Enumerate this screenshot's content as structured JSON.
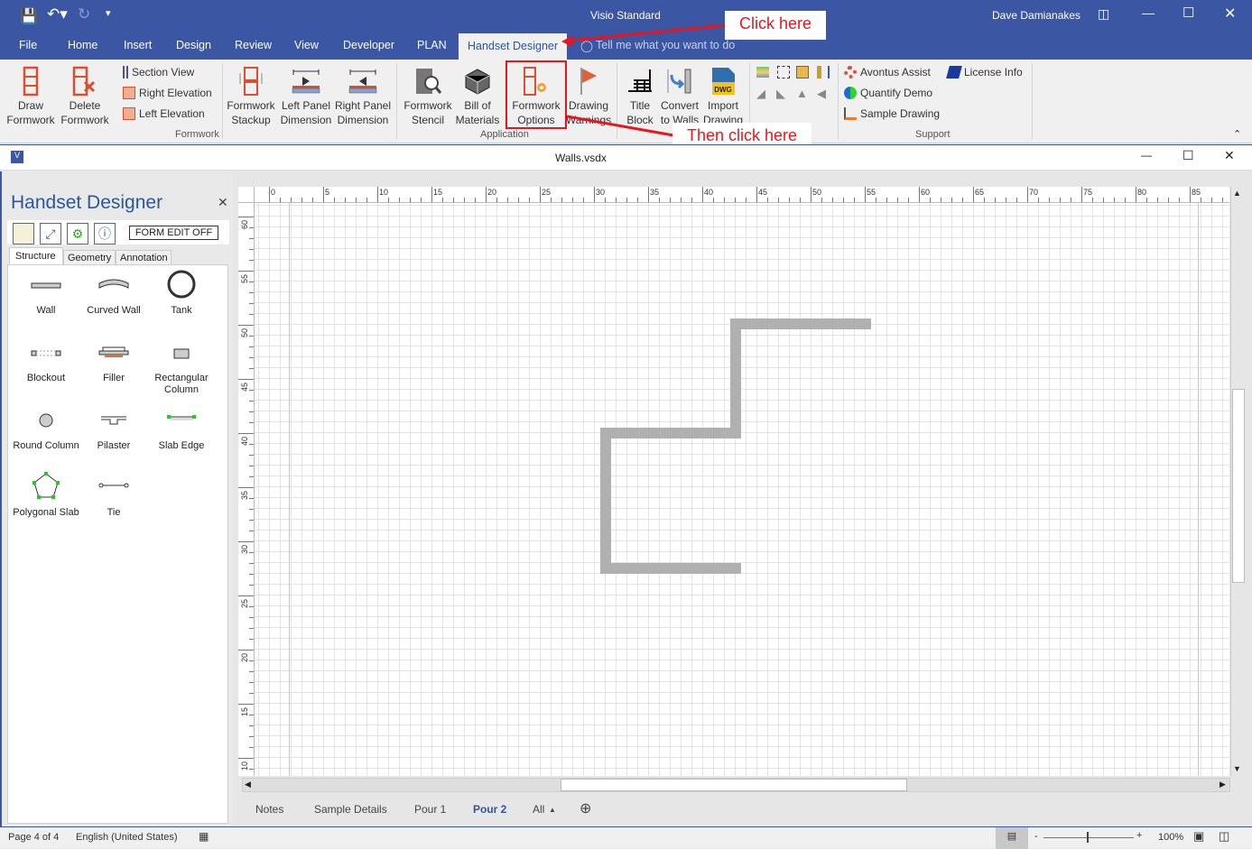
{
  "app": {
    "title": "Visio Standard",
    "user": "Dave Damianakes"
  },
  "menu_tabs": [
    "File",
    "Home",
    "Insert",
    "Design",
    "Review",
    "View",
    "Developer",
    "PLAN",
    "Handset Designer"
  ],
  "tell_me": "Tell me what you want to do",
  "ribbon": {
    "formwork": {
      "draw": [
        "Draw",
        "Formwork"
      ],
      "delete": [
        "Delete",
        "Formwork"
      ],
      "section_view": "Section View",
      "right_elevation": "Right Elevation",
      "left_elevation": "Left Elevation",
      "stackup": [
        "Formwork",
        "Stackup"
      ],
      "left_panel": [
        "Left Panel",
        "Dimension"
      ],
      "right_panel": [
        "Right Panel",
        "Dimension"
      ],
      "group": "Formwork"
    },
    "application": {
      "stencil": [
        "Formwork",
        "Stencil"
      ],
      "bom": [
        "Bill of",
        "Materials"
      ],
      "options": [
        "Formwork",
        "Options"
      ],
      "warnings": [
        "Drawing",
        "Warnings"
      ],
      "title_block": [
        "Title",
        "Block"
      ],
      "convert": [
        "Convert",
        "to Walls"
      ],
      "import": [
        "Import",
        "Drawing"
      ],
      "group": "Application",
      "dwg": "DWG"
    },
    "support": {
      "avontus": "Avontus Assist",
      "license": "License Info",
      "quantify": "Quantify Demo",
      "sample": "Sample Drawing",
      "group": "Support"
    }
  },
  "annotations": {
    "first": "Click here",
    "second": "Then click here",
    "color": "#e8161c"
  },
  "document": {
    "title": "Walls.vsdx"
  },
  "panel": {
    "title": "Handset Designer",
    "form_edit": "FORM EDIT OFF",
    "tabs": [
      "Structure",
      "Geometry",
      "Annotation"
    ],
    "shapes": [
      [
        "Wall"
      ],
      [
        "Curved Wall"
      ],
      [
        "Tank"
      ],
      [
        "Blockout"
      ],
      [
        "Filler"
      ],
      [
        "Rectangular",
        "Column"
      ],
      [
        "Round Column"
      ],
      [
        "Pilaster"
      ],
      [
        "Slab Edge"
      ],
      [
        "Polygonal Slab"
      ],
      [
        "Tie"
      ]
    ]
  },
  "ruler": {
    "h": [
      "0",
      "5",
      "10",
      "15",
      "20",
      "25",
      "30",
      "35",
      "40",
      "45",
      "50",
      "55",
      "60",
      "65",
      "70",
      "75",
      "80",
      "85"
    ],
    "v": [
      "60",
      "55",
      "50",
      "45",
      "40",
      "35",
      "30",
      "25",
      "20",
      "15",
      "10"
    ]
  },
  "page_tabs": [
    "Notes",
    "Sample Details",
    "Pour 1",
    "Pour 2",
    "All"
  ],
  "active_page": "Pour 2",
  "status": {
    "page": "Page 4 of 4",
    "language": "English (United States)",
    "zoom": "100%"
  }
}
